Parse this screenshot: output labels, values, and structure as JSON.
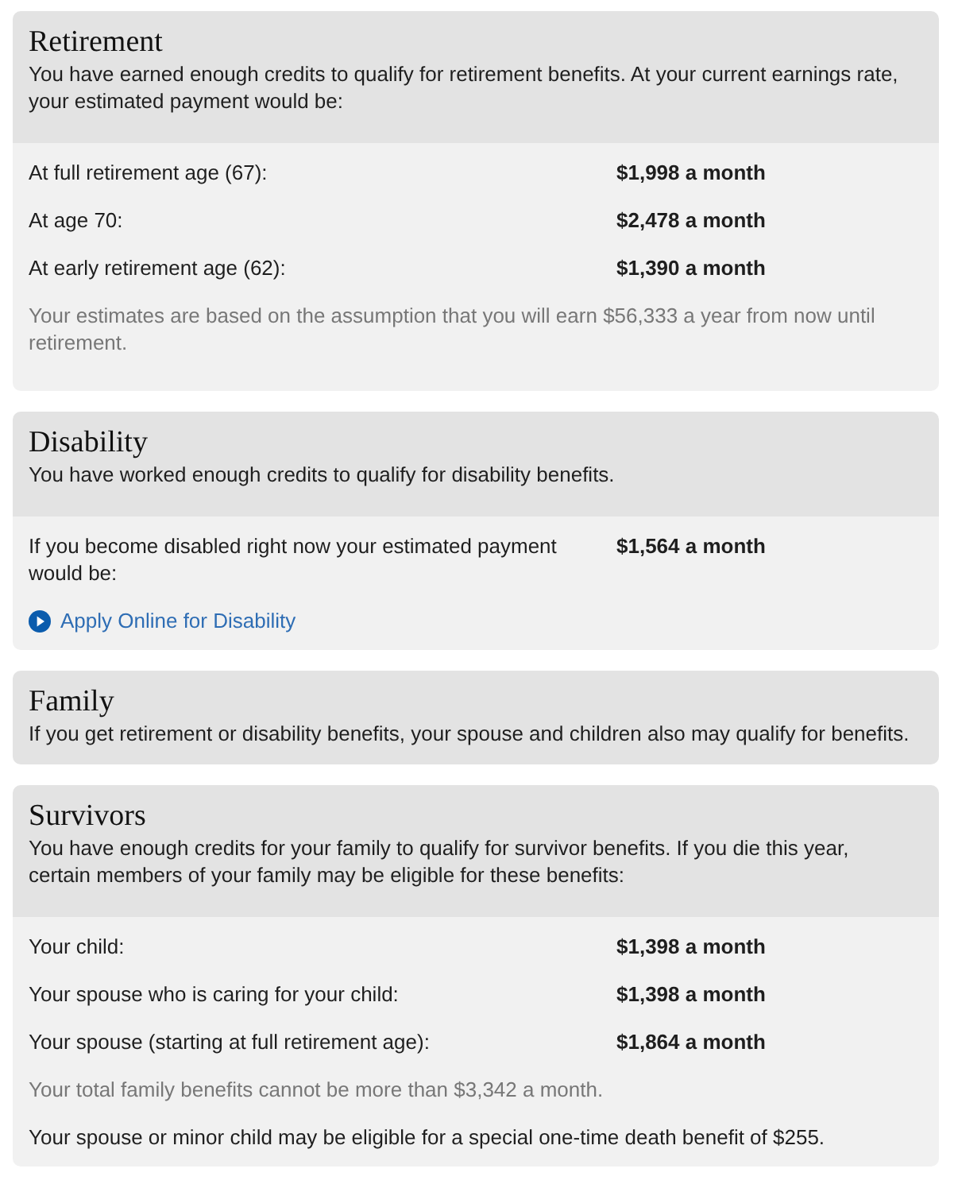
{
  "sections": [
    {
      "title": "Retirement",
      "description": "You have earned enough credits to qualify for retirement benefits. At your current earnings rate, your estimated payment would be:",
      "items": [
        {
          "kind": "row",
          "label": "At full retirement age (67):",
          "value": "$1,998 a month"
        },
        {
          "kind": "row",
          "label": "At age 70:",
          "value": "$2,478 a month"
        },
        {
          "kind": "row",
          "label": "At early retirement age (62):",
          "value": "$1,390 a month"
        },
        {
          "kind": "note",
          "muted": true,
          "text": "Your estimates are based on the assumption that you will earn $56,333 a year from now until retirement."
        }
      ]
    },
    {
      "title": "Disability",
      "description": "You have worked enough credits to qualify for disability benefits.",
      "items": [
        {
          "kind": "row",
          "label": "If you become disabled right now your estimated payment would be:",
          "value": "$1,564 a month"
        },
        {
          "kind": "link",
          "text": "Apply Online for Disability"
        }
      ]
    },
    {
      "title": "Family",
      "description": "If you get retirement or disability benefits, your spouse and children also may qualify for benefits."
    },
    {
      "title": "Survivors",
      "description": "You have enough credits for your family to qualify for survivor benefits. If you die this year, certain members of your family may be eligible for these benefits:",
      "items": [
        {
          "kind": "row",
          "label": "Your child:",
          "value": "$1,398 a month"
        },
        {
          "kind": "row",
          "label": "Your spouse who is caring for your child:",
          "value": "$1,398 a month"
        },
        {
          "kind": "row",
          "label": "Your spouse (starting at full retirement age):",
          "value": "$1,864 a month"
        },
        {
          "kind": "note",
          "muted": true,
          "text": "Your total family benefits cannot be more than $3,342 a month."
        },
        {
          "kind": "note",
          "muted": false,
          "text": "Your spouse or minor child may be eligible for a special one-time death benefit of $255."
        }
      ]
    }
  ]
}
